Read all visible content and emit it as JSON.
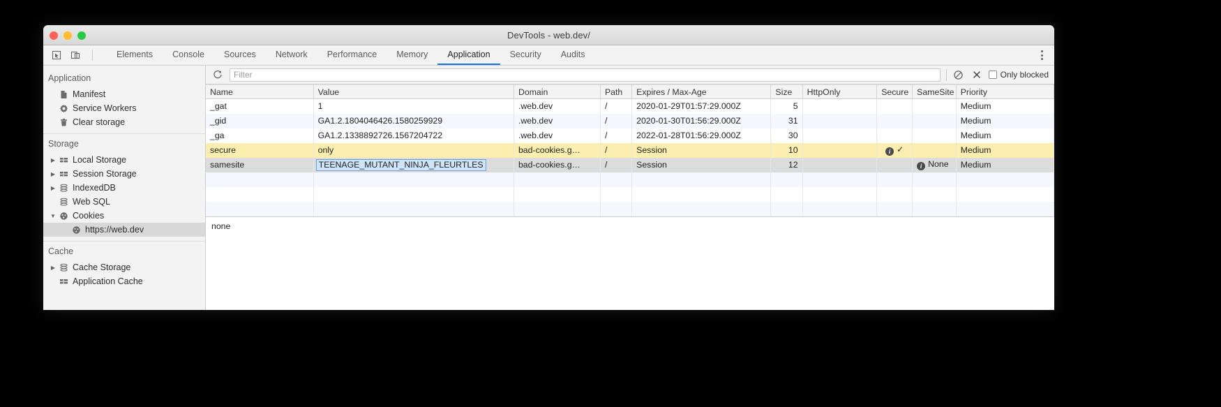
{
  "window": {
    "title": "DevTools - web.dev/",
    "traffic_lights": [
      "close",
      "minimize",
      "maximize"
    ]
  },
  "tabstrip": {
    "inspect_icon": "inspect-element-icon",
    "device_icon": "device-toolbar-icon",
    "more_icon": "more-options-icon",
    "tabs": [
      {
        "label": "Elements",
        "active": false
      },
      {
        "label": "Console",
        "active": false
      },
      {
        "label": "Sources",
        "active": false
      },
      {
        "label": "Network",
        "active": false
      },
      {
        "label": "Performance",
        "active": false
      },
      {
        "label": "Memory",
        "active": false
      },
      {
        "label": "Application",
        "active": true
      },
      {
        "label": "Security",
        "active": false
      },
      {
        "label": "Audits",
        "active": false
      }
    ]
  },
  "sidebar": {
    "groups": [
      {
        "title": "Application",
        "items": [
          {
            "label": "Manifest",
            "icon": "document-icon",
            "arrow": "none",
            "indent": 1,
            "selected": false
          },
          {
            "label": "Service Workers",
            "icon": "gear-icon",
            "arrow": "none",
            "indent": 1,
            "selected": false
          },
          {
            "label": "Clear storage",
            "icon": "trash-icon",
            "arrow": "none",
            "indent": 1,
            "selected": false
          }
        ]
      },
      {
        "title": "Storage",
        "items": [
          {
            "label": "Local Storage",
            "icon": "table-icon",
            "arrow": "collapsed",
            "indent": 0,
            "selected": false
          },
          {
            "label": "Session Storage",
            "icon": "table-icon",
            "arrow": "collapsed",
            "indent": 0,
            "selected": false
          },
          {
            "label": "IndexedDB",
            "icon": "database-icon",
            "arrow": "collapsed",
            "indent": 0,
            "selected": false
          },
          {
            "label": "Web SQL",
            "icon": "database-icon",
            "arrow": "none",
            "indent": 1,
            "selected": false
          },
          {
            "label": "Cookies",
            "icon": "cookie-icon",
            "arrow": "expanded",
            "indent": 0,
            "selected": false
          },
          {
            "label": "https://web.dev",
            "icon": "cookie-icon",
            "arrow": "none",
            "indent": 2,
            "selected": true
          }
        ]
      },
      {
        "title": "Cache",
        "items": [
          {
            "label": "Cache Storage",
            "icon": "database-icon",
            "arrow": "collapsed",
            "indent": 0,
            "selected": false
          },
          {
            "label": "Application Cache",
            "icon": "table-icon",
            "arrow": "none",
            "indent": 1,
            "selected": false
          }
        ]
      }
    ]
  },
  "filterbar": {
    "refresh_icon": "refresh-icon",
    "filter_placeholder": "Filter",
    "filter_value": "",
    "clear_icon": "clear-all-cookies-icon",
    "delete_icon": "delete-selected-cookie-icon",
    "only_blocked_label": "Only blocked",
    "only_blocked_checked": false
  },
  "table": {
    "columns": [
      "Name",
      "Value",
      "Domain",
      "Path",
      "Expires / Max-Age",
      "Size",
      "HttpOnly",
      "Secure",
      "SameSite",
      "Priority"
    ],
    "rows": [
      {
        "name": "_gat",
        "value": "1",
        "domain": ".web.dev",
        "path": "/",
        "expires": "2020-01-29T01:57:29.000Z",
        "size": "5",
        "httponly": "",
        "secure": "",
        "samesite": "",
        "priority": "Medium",
        "style": "odd",
        "editing": false
      },
      {
        "name": "_gid",
        "value": "GA1.2.1804046426.1580259929",
        "domain": ".web.dev",
        "path": "/",
        "expires": "2020-01-30T01:56:29.000Z",
        "size": "31",
        "httponly": "",
        "secure": "",
        "samesite": "",
        "priority": "Medium",
        "style": "even",
        "editing": false
      },
      {
        "name": "_ga",
        "value": "GA1.2.1338892726.1567204722",
        "domain": ".web.dev",
        "path": "/",
        "expires": "2022-01-28T01:56:29.000Z",
        "size": "30",
        "httponly": "",
        "secure": "",
        "samesite": "",
        "priority": "Medium",
        "style": "odd",
        "editing": false
      },
      {
        "name": "secure",
        "value": "only",
        "domain": "bad-cookies.g…",
        "path": "/",
        "expires": "Session",
        "size": "10",
        "httponly": "",
        "secure": "✓",
        "secure_info": true,
        "samesite": "",
        "priority": "Medium",
        "style": "warn",
        "editing": false
      },
      {
        "name": "samesite",
        "value": "TEENAGE_MUTANT_NINJA_FLEURTLES",
        "domain": "bad-cookies.g…",
        "path": "/",
        "expires": "Session",
        "size": "12",
        "httponly": "",
        "secure": "",
        "samesite": "None",
        "samesite_info": true,
        "priority": "Medium",
        "style": "sel",
        "editing": true
      }
    ],
    "empty_rows": 2
  },
  "preview": {
    "text": "none"
  },
  "colors": {
    "accent": "#1a73e8",
    "warn_row": "#fbeeaf",
    "selected_row": "#dcdcdc",
    "alt_row": "#f4f8fe",
    "edit_highlight": "#cfe4f7"
  }
}
